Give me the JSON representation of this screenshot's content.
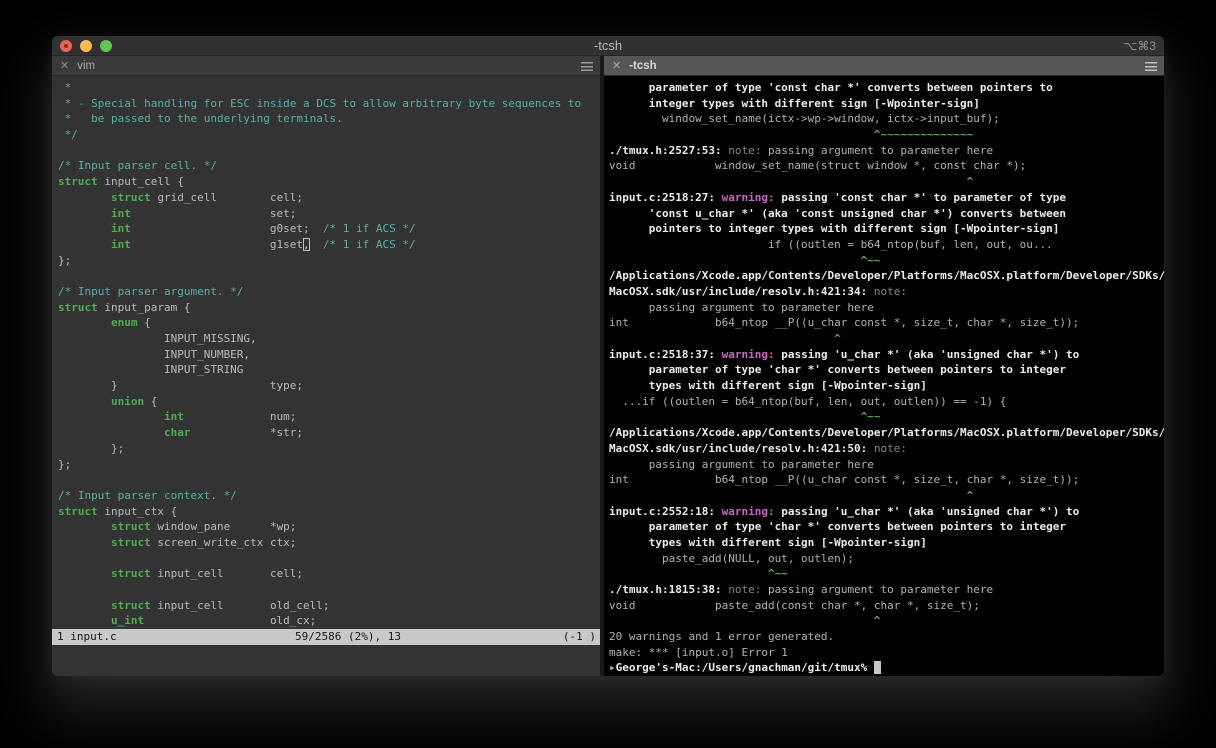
{
  "window": {
    "title": "-tcsh",
    "shortcut": "⌥⌘3"
  },
  "colors": {
    "vim_bg": "#333333",
    "shell_bg": "#000000",
    "comment": "#55b3a6",
    "keyword": "#4caf50",
    "warning": "#cd63c6",
    "caret": "#4eb44e",
    "status_bg": "#c9c9c9",
    "tab_active_bg": "#565656",
    "tab_inactive_bg": "#3a3a3a"
  },
  "panes": {
    "left": {
      "tab": {
        "close_glyph": "✕",
        "label": "vim"
      },
      "status": {
        "left": "1 input.c",
        "mid": "59/2586 (2%), 13",
        "right": "(-1 )"
      },
      "lines": [
        [
          [
            "c",
            " *"
          ]
        ],
        [
          [
            "c",
            " * - Special handling for ESC inside a DCS to allow arbitrary byte sequences to"
          ]
        ],
        [
          [
            "c",
            " *   be passed to the underlying terminals."
          ]
        ],
        [
          [
            "c",
            " */"
          ]
        ],
        [],
        [
          [
            "c",
            "/* Input parser cell. */"
          ]
        ],
        [
          [
            "k",
            "struct"
          ],
          [
            "t",
            " input_cell {"
          ]
        ],
        [
          [
            "t",
            "        "
          ],
          [
            "k",
            "struct"
          ],
          [
            "t",
            " grid_cell        cell;"
          ]
        ],
        [
          [
            "t",
            "        "
          ],
          [
            "k",
            "int"
          ],
          [
            "t",
            "                     set;"
          ]
        ],
        [
          [
            "t",
            "        "
          ],
          [
            "k",
            "int"
          ],
          [
            "t",
            "                     g0set;  "
          ],
          [
            "c",
            "/* 1 if ACS */"
          ]
        ],
        [
          [
            "t",
            "        "
          ],
          [
            "k",
            "int"
          ],
          [
            "t",
            "                     g1set"
          ],
          [
            "hc",
            ","
          ],
          [
            "t",
            "  "
          ],
          [
            "c",
            "/* 1 if ACS */"
          ]
        ],
        [
          [
            "t",
            "};"
          ]
        ],
        [],
        [
          [
            "c",
            "/* Input parser argument. */"
          ]
        ],
        [
          [
            "k",
            "struct"
          ],
          [
            "t",
            " input_param {"
          ]
        ],
        [
          [
            "t",
            "        "
          ],
          [
            "k",
            "enum"
          ],
          [
            "t",
            " {"
          ]
        ],
        [
          [
            "t",
            "                INPUT_MISSING,"
          ]
        ],
        [
          [
            "t",
            "                INPUT_NUMBER,"
          ]
        ],
        [
          [
            "t",
            "                INPUT_STRING"
          ]
        ],
        [
          [
            "t",
            "        }                       type;"
          ]
        ],
        [
          [
            "t",
            "        "
          ],
          [
            "k",
            "union"
          ],
          [
            "t",
            " {"
          ]
        ],
        [
          [
            "t",
            "                "
          ],
          [
            "k",
            "int"
          ],
          [
            "t",
            "             num;"
          ]
        ],
        [
          [
            "t",
            "                "
          ],
          [
            "k",
            "char"
          ],
          [
            "t",
            "            *str;"
          ]
        ],
        [
          [
            "t",
            "        };"
          ]
        ],
        [
          [
            "t",
            "};"
          ]
        ],
        [],
        [
          [
            "c",
            "/* Input parser context. */"
          ]
        ],
        [
          [
            "k",
            "struct"
          ],
          [
            "t",
            " input_ctx {"
          ]
        ],
        [
          [
            "t",
            "        "
          ],
          [
            "k",
            "struct"
          ],
          [
            "t",
            " window_pane      *wp;"
          ]
        ],
        [
          [
            "t",
            "        "
          ],
          [
            "k",
            "struct"
          ],
          [
            "t",
            " screen_write_ctx ctx;"
          ]
        ],
        [],
        [
          [
            "t",
            "        "
          ],
          [
            "k",
            "struct"
          ],
          [
            "t",
            " input_cell       cell;"
          ]
        ],
        [],
        [
          [
            "t",
            "        "
          ],
          [
            "k",
            "struct"
          ],
          [
            "t",
            " input_cell       old_cell;"
          ]
        ],
        [
          [
            "t",
            "        "
          ],
          [
            "k",
            "u_int"
          ],
          [
            "t",
            "                   old_cx;"
          ]
        ]
      ]
    },
    "right": {
      "tab": {
        "close_glyph": "✕",
        "label": "-tcsh"
      },
      "lines": [
        [
          [
            "b",
            "      parameter of type 'const char *' converts between pointers to"
          ]
        ],
        [
          [
            "b",
            "      integer types with different sign [-Wpointer-sign]"
          ]
        ],
        [
          [
            "n",
            "        window_set_name(ictx->wp->window, ictx->input_buf);"
          ]
        ],
        [
          [
            "g",
            "                                        ^~~~~~~~~~~~~~~"
          ]
        ],
        [
          [
            "b",
            "./tmux.h:2527:53: "
          ],
          [
            "d",
            "note: "
          ],
          [
            "n",
            "passing argument to parameter here"
          ]
        ],
        [
          [
            "n",
            "void            window_set_name(struct window *, const char *);"
          ]
        ],
        [
          [
            "g",
            "                                                      ^"
          ]
        ],
        [
          [
            "b",
            "input.c:2518:27: "
          ],
          [
            "w",
            "warning: "
          ],
          [
            "b",
            "passing 'const char *' to parameter of type"
          ]
        ],
        [
          [
            "b",
            "      'const u_char *' (aka 'const unsigned char *') converts between"
          ]
        ],
        [
          [
            "b",
            "      pointers to integer types with different sign [-Wpointer-sign]"
          ]
        ],
        [
          [
            "n",
            "                        if ((outlen = b64_ntop(buf, len, out, ou..."
          ]
        ],
        [
          [
            "g",
            "                                      ^~~"
          ]
        ],
        [
          [
            "b",
            "/Applications/Xcode.app/Contents/Developer/Platforms/MacOSX.platform/Developer/SDKs/"
          ]
        ],
        [
          [
            "b",
            "MacOSX.sdk/usr/include/resolv.h:421:34: "
          ],
          [
            "d",
            "note:"
          ]
        ],
        [
          [
            "n",
            "      passing argument to parameter here"
          ]
        ],
        [
          [
            "n",
            "int             b64_ntop __P((u_char const *, size_t, char *, size_t));"
          ]
        ],
        [
          [
            "g",
            "                                  ^"
          ]
        ],
        [
          [
            "b",
            "input.c:2518:37: "
          ],
          [
            "w",
            "warning: "
          ],
          [
            "b",
            "passing 'u_char *' (aka 'unsigned char *') to"
          ]
        ],
        [
          [
            "b",
            "      parameter of type 'char *' converts between pointers to integer"
          ]
        ],
        [
          [
            "b",
            "      types with different sign [-Wpointer-sign]"
          ]
        ],
        [
          [
            "n",
            "  ...if ((outlen = b64_ntop(buf, len, out, outlen)) == -1) {"
          ]
        ],
        [
          [
            "g",
            "                                      ^~~"
          ]
        ],
        [
          [
            "b",
            "/Applications/Xcode.app/Contents/Developer/Platforms/MacOSX.platform/Developer/SDKs/"
          ]
        ],
        [
          [
            "b",
            "MacOSX.sdk/usr/include/resolv.h:421:50: "
          ],
          [
            "d",
            "note:"
          ]
        ],
        [
          [
            "n",
            "      passing argument to parameter here"
          ]
        ],
        [
          [
            "n",
            "int             b64_ntop __P((u_char const *, size_t, char *, size_t));"
          ]
        ],
        [
          [
            "g",
            "                                                      ^"
          ]
        ],
        [
          [
            "b",
            "input.c:2552:18: "
          ],
          [
            "w",
            "warning: "
          ],
          [
            "b",
            "passing 'u_char *' (aka 'unsigned char *') to"
          ]
        ],
        [
          [
            "b",
            "      parameter of type 'char *' converts between pointers to integer"
          ]
        ],
        [
          [
            "b",
            "      types with different sign [-Wpointer-sign]"
          ]
        ],
        [
          [
            "n",
            "        paste_add(NULL, out, outlen);"
          ]
        ],
        [
          [
            "g",
            "                        ^~~"
          ]
        ],
        [
          [
            "b",
            "./tmux.h:1815:38: "
          ],
          [
            "d",
            "note: "
          ],
          [
            "n",
            "passing argument to parameter here"
          ]
        ],
        [
          [
            "n",
            "void            paste_add(const char *, char *, size_t);"
          ]
        ],
        [
          [
            "g",
            "                                        ^"
          ]
        ],
        [
          [
            "n",
            "20 warnings and 1 error generated."
          ]
        ],
        [
          [
            "n",
            "make: *** [input.o] Error 1"
          ]
        ],
        [
          [
            "m",
            "▸"
          ],
          [
            "b",
            "George's-Mac:/Users/gnachman/git/tmux% "
          ],
          [
            "cur",
            " "
          ]
        ]
      ]
    }
  }
}
